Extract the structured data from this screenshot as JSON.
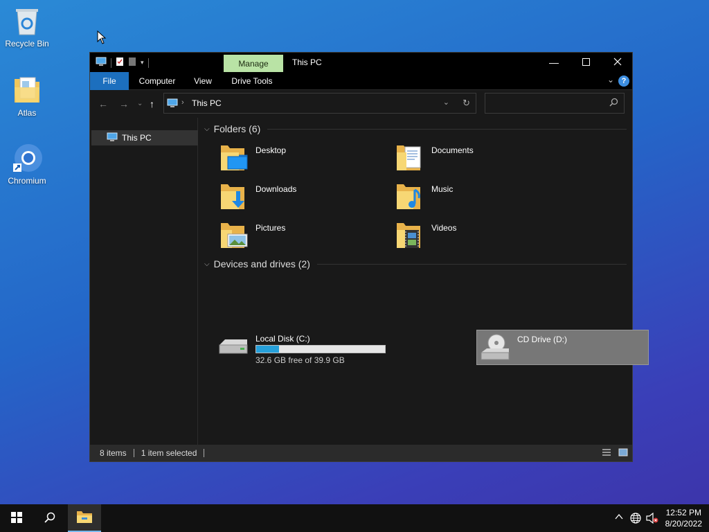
{
  "desktop": {
    "icons": [
      {
        "label": "Recycle Bin",
        "icon": "recycle-bin-icon"
      },
      {
        "label": "Atlas",
        "icon": "folder-document-icon"
      },
      {
        "label": "Chromium",
        "icon": "chromium-icon"
      }
    ]
  },
  "window": {
    "title": "This PC",
    "manage_tab": "Manage",
    "ribbon_tabs": [
      "File",
      "Computer",
      "View",
      "Drive Tools"
    ],
    "help_label": "?",
    "address": {
      "path": "This PC"
    },
    "search": {
      "placeholder": ""
    },
    "nav_pane": {
      "selected_item": "This PC"
    },
    "folders_header": "Folders (6)",
    "folders": [
      {
        "name": "Desktop",
        "icon": "desktop-folder-icon"
      },
      {
        "name": "Documents",
        "icon": "documents-folder-icon"
      },
      {
        "name": "Downloads",
        "icon": "downloads-folder-icon"
      },
      {
        "name": "Music",
        "icon": "music-folder-icon"
      },
      {
        "name": "Pictures",
        "icon": "pictures-folder-icon"
      },
      {
        "name": "Videos",
        "icon": "videos-folder-icon"
      }
    ],
    "drives_header": "Devices and drives (2)",
    "drives": [
      {
        "name": "Local Disk (C:)",
        "free_text": "32.6 GB free of 39.9 GB",
        "used_fraction": 0.18,
        "icon": "hard-drive-icon"
      },
      {
        "name": "CD Drive (D:)",
        "icon": "cd-drive-icon",
        "selected": true
      }
    ],
    "status": {
      "items": "8 items",
      "selected": "1 item selected"
    }
  },
  "taskbar": {
    "clock_time": "12:52 PM",
    "clock_date": "8/20/2022"
  },
  "colors": {
    "accent": "#1c6fbe",
    "manage_tab": "#b9e3a5",
    "progress": "#26a0da"
  }
}
